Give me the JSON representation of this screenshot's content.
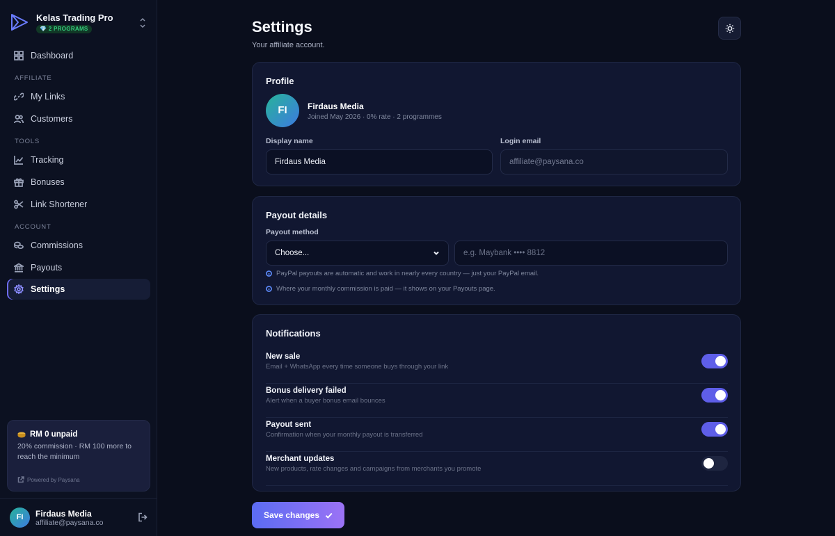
{
  "brand": {
    "name": "Kelas Trading Pro",
    "badge": "💎 2 PROGRAMS"
  },
  "sidebar": {
    "dashboard": "Dashboard",
    "sections": {
      "affiliate": "AFFILIATE",
      "tools": "TOOLS",
      "account": "ACCOUNT"
    },
    "items": {
      "my_links": "My Links",
      "customers": "Customers",
      "tracking": "Tracking",
      "bonuses": "Bonuses",
      "link_shortener": "Link Shortener",
      "commissions": "Commissions",
      "payouts": "Payouts",
      "settings": "Settings"
    },
    "earnings": {
      "title": "RM 0 unpaid",
      "text": "20% commission · RM 100 more to reach the minimum",
      "powered": "Powered by Paysana"
    },
    "user": {
      "initials": "FI",
      "name": "Firdaus Media",
      "email": "affiliate@paysana.co"
    }
  },
  "header": {
    "title": "Settings",
    "subtitle": "Your affiliate account."
  },
  "profile": {
    "title": "Profile",
    "initials": "FI",
    "name": "Firdaus Media",
    "meta": "Joined May 2026 · 0% rate · 2 programmes",
    "display_name_label": "Display name",
    "display_name_value": "Firdaus Media",
    "login_email_label": "Login email",
    "login_email_value": "affiliate@paysana.co"
  },
  "payout": {
    "title": "Payout details",
    "method_label": "Payout method",
    "method_value": "Choose...",
    "account_placeholder": "e.g. Maybank •••• 8812",
    "hint1": "PayPal payouts are automatic and work in nearly every country — just your PayPal email.",
    "hint2": "Where your monthly commission is paid — it shows on your Payouts page."
  },
  "notifications": {
    "title": "Notifications",
    "items": [
      {
        "title": "New sale",
        "desc": "Email + WhatsApp every time someone buys through your link",
        "enabled": true
      },
      {
        "title": "Bonus delivery failed",
        "desc": "Alert when a buyer bonus email bounces",
        "enabled": true
      },
      {
        "title": "Payout sent",
        "desc": "Confirmation when your monthly payout is transferred",
        "enabled": true
      },
      {
        "title": "Merchant updates",
        "desc": "New products, rate changes and campaigns from merchants you promote",
        "enabled": false
      }
    ]
  },
  "save_label": "Save changes",
  "colors": {
    "accent": "#5e5ee8",
    "background": "#0a0e1c",
    "card": "#111731",
    "badge_green": "#35d07f"
  }
}
